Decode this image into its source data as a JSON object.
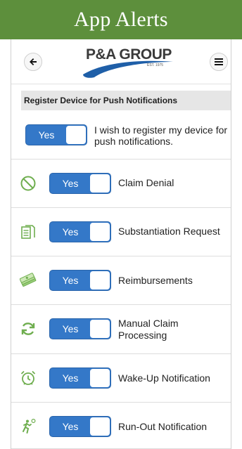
{
  "banner": {
    "title": "App Alerts"
  },
  "logo": {
    "name": "P&A GROUP",
    "est": "EST. 1975"
  },
  "section": {
    "title": "Register Device for Push Notifications"
  },
  "master": {
    "toggle_label": "Yes",
    "text": "I wish to register my device for push notifications."
  },
  "colors": {
    "banner": "#5d8f3c",
    "toggle": "#3478c8",
    "icon": "#6fae4f"
  },
  "alerts": [
    {
      "icon": "prohibited-icon",
      "toggle_label": "Yes",
      "label": "Claim Denial"
    },
    {
      "icon": "document-icon",
      "toggle_label": "Yes",
      "label": "Substantiation Request"
    },
    {
      "icon": "money-stack-icon",
      "toggle_label": "Yes",
      "label": "Reimbursements"
    },
    {
      "icon": "refresh-icon",
      "toggle_label": "Yes",
      "label": "Manual Claim Processing"
    },
    {
      "icon": "alarm-clock-icon",
      "toggle_label": "Yes",
      "label": "Wake-Up Notification"
    },
    {
      "icon": "runner-icon",
      "toggle_label": "Yes",
      "label": "Run-Out Notification"
    }
  ]
}
